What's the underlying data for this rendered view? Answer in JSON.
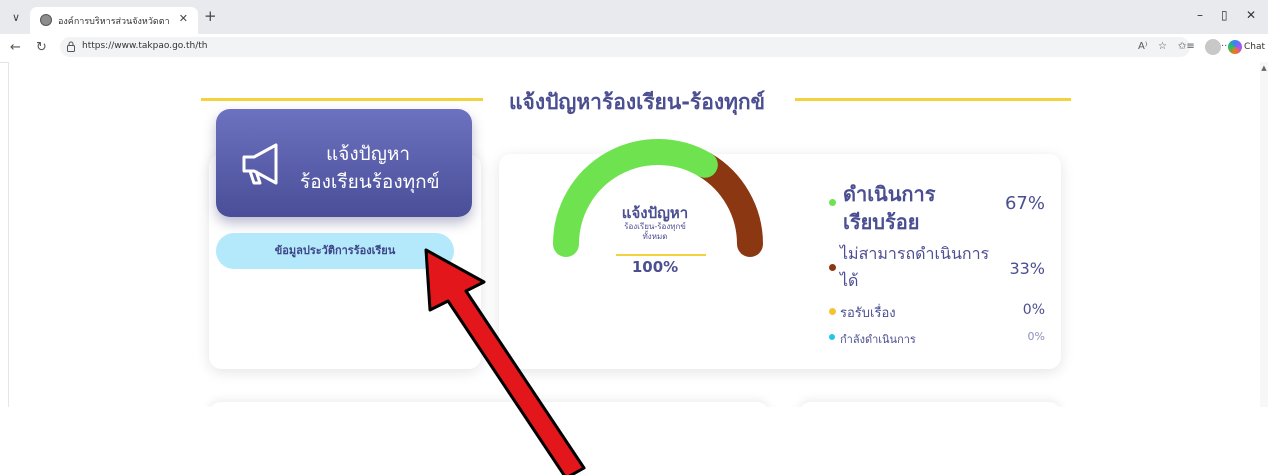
{
  "browser": {
    "tab_title": "องค์การบริหารส่วนจังหวัดตาก",
    "url": "https://www.takpao.go.th/th",
    "chat_label": "Chat"
  },
  "section": {
    "title": "แจ้งปัญหาร้องเรียน-ร้องทุกข์"
  },
  "report_button": {
    "line1": "แจ้งปัญหา",
    "line2": "ร้องเรียนร้องทุกข์"
  },
  "history_button": {
    "label": "ข้อมูลประวัติการร้องเรียน"
  },
  "gauge": {
    "title": "แจ้งปัญหา",
    "subtitle_line1": "ร้องเรียน-ร้องทุกข์",
    "subtitle_line2": "ทั้งหมด",
    "total_percent": "100%",
    "segments": [
      {
        "label": "ดำเนินการเรียบร้อย",
        "fraction": 0.67,
        "color": "#6fe34f"
      },
      {
        "label": "ไม่สามารถดำเนินการได้",
        "fraction": 0.33,
        "color": "#8b3711"
      }
    ]
  },
  "legend": [
    {
      "label_line1": "ดำเนินการ",
      "label_line2": "เรียบร้อย",
      "value": "67%",
      "color": "#6fe34f"
    },
    {
      "label_line1": "ไม่สามารถดำเนินการ",
      "label_line2": "ได้",
      "value": "33%",
      "color": "#8b3711"
    },
    {
      "label": "รอรับเรื่อง",
      "value": "0%",
      "color": "#f4c430"
    },
    {
      "label": "กำลังดำเนินการ",
      "value": "0%",
      "color": "#22c7e8"
    }
  ]
}
